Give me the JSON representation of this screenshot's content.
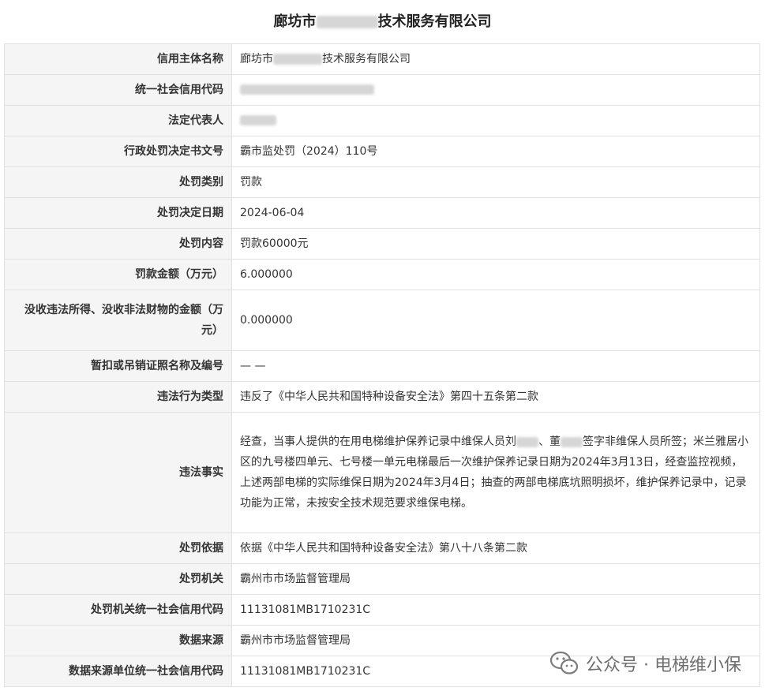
{
  "page": {
    "title_prefix": "廊坊市",
    "title_suffix": "技术服务有限公司"
  },
  "rows": [
    {
      "label": "信用主体名称",
      "value_prefix": "廊坊市",
      "value_suffix": "技术服务有限公司"
    },
    {
      "label": "统一社会信用代码",
      "value": ""
    },
    {
      "label": "法定代表人",
      "value": ""
    },
    {
      "label": "行政处罚决定书文号",
      "value": "霸市监处罚（2024）110号"
    },
    {
      "label": "处罚类别",
      "value": "罚款"
    },
    {
      "label": "处罚决定日期",
      "value": "2024-06-04"
    },
    {
      "label": "处罚内容",
      "value": "罚款60000元"
    },
    {
      "label": "罚款金额（万元）",
      "value": "6.000000"
    },
    {
      "label": "没收违法所得、没收非法财物的金额（万元）",
      "value": "0.000000"
    },
    {
      "label": "暂扣或吊销证照名称及编号",
      "value": "— —"
    },
    {
      "label": "违法行为类型",
      "value": "违反了《中华人民共和国特种设备安全法》第四十五条第二款"
    },
    {
      "label": "违法事实",
      "value_part1": "经查，当事人提供的在用电梯维护保养记录中维保人员刘",
      "value_part2": "、董",
      "value_part3": "签字非维保人员所签；米兰雅居小区的九号楼四单元、七号楼一单元电梯最后一次维护保养记录日期为2024年3月13日，经查监控视频，上述两部电梯的实际维保日期为2024年3月4日；抽查的两部电梯底坑照明损坏，维护保养记录中，记录功能为正常，未按安全技术规范要求维保电梯。"
    },
    {
      "label": "处罚依据",
      "value": "依据《中华人民共和国特种设备安全法》第八十八条第二款"
    },
    {
      "label": "处罚机关",
      "value": "霸州市市场监督管理局"
    },
    {
      "label": "处罚机关统一社会信用代码",
      "value": "11131081MB1710231C"
    },
    {
      "label": "数据来源",
      "value": "霸州市市场监督管理局"
    },
    {
      "label": "数据来源单位统一社会信用代码",
      "value": "11131081MB1710231C"
    }
  ],
  "watermark": {
    "text": "公众号 · 电梯维小保",
    "icon": "wechat-icon"
  }
}
